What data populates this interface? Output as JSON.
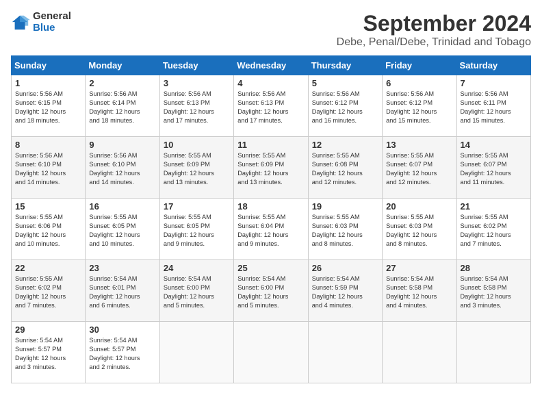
{
  "logo": {
    "general": "General",
    "blue": "Blue"
  },
  "title": "September 2024",
  "subtitle": "Debe, Penal/Debe, Trinidad and Tobago",
  "calendar": {
    "headers": [
      "Sunday",
      "Monday",
      "Tuesday",
      "Wednesday",
      "Thursday",
      "Friday",
      "Saturday"
    ],
    "rows": [
      [
        {
          "day": "1",
          "lines": [
            "Sunrise: 5:56 AM",
            "Sunset: 6:15 PM",
            "Daylight: 12 hours",
            "and 18 minutes."
          ]
        },
        {
          "day": "2",
          "lines": [
            "Sunrise: 5:56 AM",
            "Sunset: 6:14 PM",
            "Daylight: 12 hours",
            "and 18 minutes."
          ]
        },
        {
          "day": "3",
          "lines": [
            "Sunrise: 5:56 AM",
            "Sunset: 6:13 PM",
            "Daylight: 12 hours",
            "and 17 minutes."
          ]
        },
        {
          "day": "4",
          "lines": [
            "Sunrise: 5:56 AM",
            "Sunset: 6:13 PM",
            "Daylight: 12 hours",
            "and 17 minutes."
          ]
        },
        {
          "day": "5",
          "lines": [
            "Sunrise: 5:56 AM",
            "Sunset: 6:12 PM",
            "Daylight: 12 hours",
            "and 16 minutes."
          ]
        },
        {
          "day": "6",
          "lines": [
            "Sunrise: 5:56 AM",
            "Sunset: 6:12 PM",
            "Daylight: 12 hours",
            "and 15 minutes."
          ]
        },
        {
          "day": "7",
          "lines": [
            "Sunrise: 5:56 AM",
            "Sunset: 6:11 PM",
            "Daylight: 12 hours",
            "and 15 minutes."
          ]
        }
      ],
      [
        {
          "day": "8",
          "lines": [
            "Sunrise: 5:56 AM",
            "Sunset: 6:10 PM",
            "Daylight: 12 hours",
            "and 14 minutes."
          ]
        },
        {
          "day": "9",
          "lines": [
            "Sunrise: 5:56 AM",
            "Sunset: 6:10 PM",
            "Daylight: 12 hours",
            "and 14 minutes."
          ]
        },
        {
          "day": "10",
          "lines": [
            "Sunrise: 5:55 AM",
            "Sunset: 6:09 PM",
            "Daylight: 12 hours",
            "and 13 minutes."
          ]
        },
        {
          "day": "11",
          "lines": [
            "Sunrise: 5:55 AM",
            "Sunset: 6:09 PM",
            "Daylight: 12 hours",
            "and 13 minutes."
          ]
        },
        {
          "day": "12",
          "lines": [
            "Sunrise: 5:55 AM",
            "Sunset: 6:08 PM",
            "Daylight: 12 hours",
            "and 12 minutes."
          ]
        },
        {
          "day": "13",
          "lines": [
            "Sunrise: 5:55 AM",
            "Sunset: 6:07 PM",
            "Daylight: 12 hours",
            "and 12 minutes."
          ]
        },
        {
          "day": "14",
          "lines": [
            "Sunrise: 5:55 AM",
            "Sunset: 6:07 PM",
            "Daylight: 12 hours",
            "and 11 minutes."
          ]
        }
      ],
      [
        {
          "day": "15",
          "lines": [
            "Sunrise: 5:55 AM",
            "Sunset: 6:06 PM",
            "Daylight: 12 hours",
            "and 10 minutes."
          ]
        },
        {
          "day": "16",
          "lines": [
            "Sunrise: 5:55 AM",
            "Sunset: 6:05 PM",
            "Daylight: 12 hours",
            "and 10 minutes."
          ]
        },
        {
          "day": "17",
          "lines": [
            "Sunrise: 5:55 AM",
            "Sunset: 6:05 PM",
            "Daylight: 12 hours",
            "and 9 minutes."
          ]
        },
        {
          "day": "18",
          "lines": [
            "Sunrise: 5:55 AM",
            "Sunset: 6:04 PM",
            "Daylight: 12 hours",
            "and 9 minutes."
          ]
        },
        {
          "day": "19",
          "lines": [
            "Sunrise: 5:55 AM",
            "Sunset: 6:03 PM",
            "Daylight: 12 hours",
            "and 8 minutes."
          ]
        },
        {
          "day": "20",
          "lines": [
            "Sunrise: 5:55 AM",
            "Sunset: 6:03 PM",
            "Daylight: 12 hours",
            "and 8 minutes."
          ]
        },
        {
          "day": "21",
          "lines": [
            "Sunrise: 5:55 AM",
            "Sunset: 6:02 PM",
            "Daylight: 12 hours",
            "and 7 minutes."
          ]
        }
      ],
      [
        {
          "day": "22",
          "lines": [
            "Sunrise: 5:55 AM",
            "Sunset: 6:02 PM",
            "Daylight: 12 hours",
            "and 7 minutes."
          ]
        },
        {
          "day": "23",
          "lines": [
            "Sunrise: 5:54 AM",
            "Sunset: 6:01 PM",
            "Daylight: 12 hours",
            "and 6 minutes."
          ]
        },
        {
          "day": "24",
          "lines": [
            "Sunrise: 5:54 AM",
            "Sunset: 6:00 PM",
            "Daylight: 12 hours",
            "and 5 minutes."
          ]
        },
        {
          "day": "25",
          "lines": [
            "Sunrise: 5:54 AM",
            "Sunset: 6:00 PM",
            "Daylight: 12 hours",
            "and 5 minutes."
          ]
        },
        {
          "day": "26",
          "lines": [
            "Sunrise: 5:54 AM",
            "Sunset: 5:59 PM",
            "Daylight: 12 hours",
            "and 4 minutes."
          ]
        },
        {
          "day": "27",
          "lines": [
            "Sunrise: 5:54 AM",
            "Sunset: 5:58 PM",
            "Daylight: 12 hours",
            "and 4 minutes."
          ]
        },
        {
          "day": "28",
          "lines": [
            "Sunrise: 5:54 AM",
            "Sunset: 5:58 PM",
            "Daylight: 12 hours",
            "and 3 minutes."
          ]
        }
      ],
      [
        {
          "day": "29",
          "lines": [
            "Sunrise: 5:54 AM",
            "Sunset: 5:57 PM",
            "Daylight: 12 hours",
            "and 3 minutes."
          ]
        },
        {
          "day": "30",
          "lines": [
            "Sunrise: 5:54 AM",
            "Sunset: 5:57 PM",
            "Daylight: 12 hours",
            "and 2 minutes."
          ]
        },
        {
          "day": "",
          "lines": []
        },
        {
          "day": "",
          "lines": []
        },
        {
          "day": "",
          "lines": []
        },
        {
          "day": "",
          "lines": []
        },
        {
          "day": "",
          "lines": []
        }
      ]
    ]
  }
}
